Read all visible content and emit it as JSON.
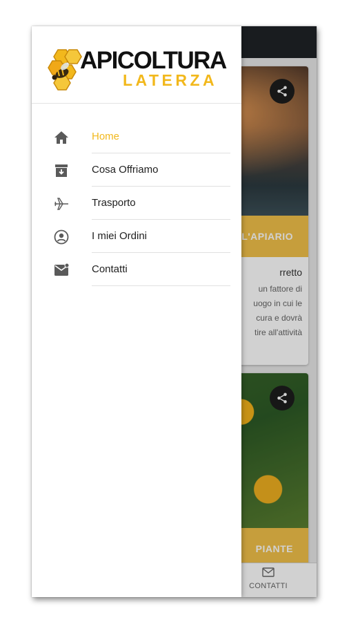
{
  "brand": {
    "title": "APICOLTURA",
    "subtitle": "LATERZA",
    "accent_color": "#f2b81c"
  },
  "drawer": {
    "items": [
      {
        "label": "Home",
        "icon": "home-icon",
        "active": true
      },
      {
        "label": "Cosa Offriamo",
        "icon": "archive-icon",
        "active": false
      },
      {
        "label": "Trasporto",
        "icon": "airplane-icon",
        "active": false
      },
      {
        "label": "I miei Ordini",
        "icon": "account-circle-icon",
        "active": false
      },
      {
        "label": "Contatti",
        "icon": "mail-icon",
        "active": false
      }
    ]
  },
  "background_app": {
    "card1": {
      "band_label": "L'APIARIO",
      "desc_title": "rretto",
      "desc_text": [
        "un fattore di",
        "uogo in cui le",
        "cura e dovrà",
        "tire all'attività"
      ]
    },
    "card2": {
      "band_label": "PIANTE"
    },
    "bottom_nav": {
      "contatti_label": "CONTATTI"
    }
  }
}
